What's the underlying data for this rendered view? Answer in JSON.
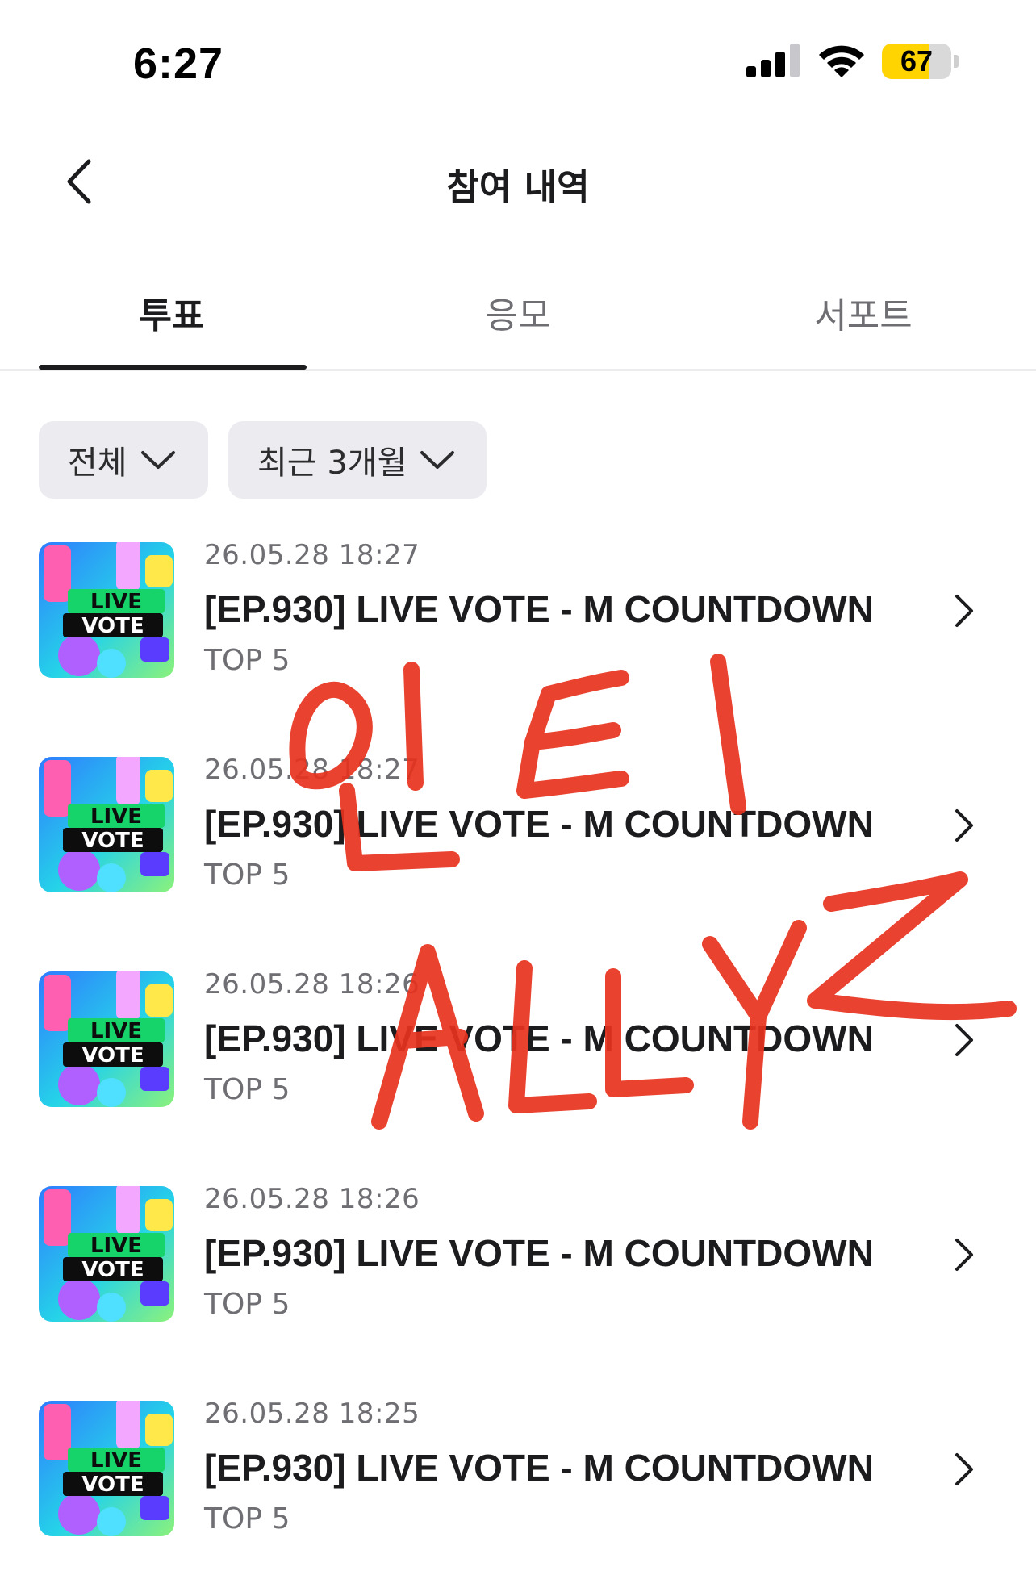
{
  "status_bar": {
    "time": "6:27",
    "battery_level": "67",
    "battery_fill": 0.67,
    "signal_icon": "cellular-signal-icon",
    "wifi_icon": "wifi-icon"
  },
  "header": {
    "title": "참여 내역",
    "back_icon": "chevron-left-icon"
  },
  "tabs": [
    {
      "label": "투표",
      "active": true
    },
    {
      "label": "응모",
      "active": false
    },
    {
      "label": "서포트",
      "active": false
    }
  ],
  "filters": {
    "category": {
      "selected": "전체",
      "icon": "chevron-down-icon"
    },
    "period": {
      "selected": "최근 3개월",
      "icon": "chevron-down-icon"
    }
  },
  "items": [
    {
      "date": "26.05.28 18:27",
      "title": "[EP.930] LIVE VOTE - M COUNTDOWN",
      "subtitle": "TOP 5",
      "thumb_text_1": "LIVE",
      "thumb_text_2": "VOTE"
    },
    {
      "date": "26.05.28 18:27",
      "title": "[EP.930] LIVE VOTE - M COUNTDOWN",
      "subtitle": "TOP 5",
      "thumb_text_1": "LIVE",
      "thumb_text_2": "VOTE"
    },
    {
      "date": "26.05.28 18:26",
      "title": "[EP.930] LIVE VOTE - M COUNTDOWN",
      "subtitle": "TOP 5",
      "thumb_text_1": "LIVE",
      "thumb_text_2": "VOTE"
    },
    {
      "date": "26.05.28 18:26",
      "title": "[EP.930] LIVE VOTE - M COUNTDOWN",
      "subtitle": "TOP 5",
      "thumb_text_1": "LIVE",
      "thumb_text_2": "VOTE"
    },
    {
      "date": "26.05.28 18:25",
      "title": "[EP.930] LIVE VOTE - M COUNTDOWN",
      "subtitle": "TOP 5",
      "thumb_text_1": "LIVE",
      "thumb_text_2": "VOTE"
    }
  ],
  "watermark": {
    "line1": "인티",
    "line2": "ALLYZ",
    "color": "#e8321e"
  },
  "colors": {
    "text_primary": "#1c1c1e",
    "text_secondary": "#6e6e73",
    "filter_bg": "#ececf0",
    "battery": "#ffd400"
  }
}
